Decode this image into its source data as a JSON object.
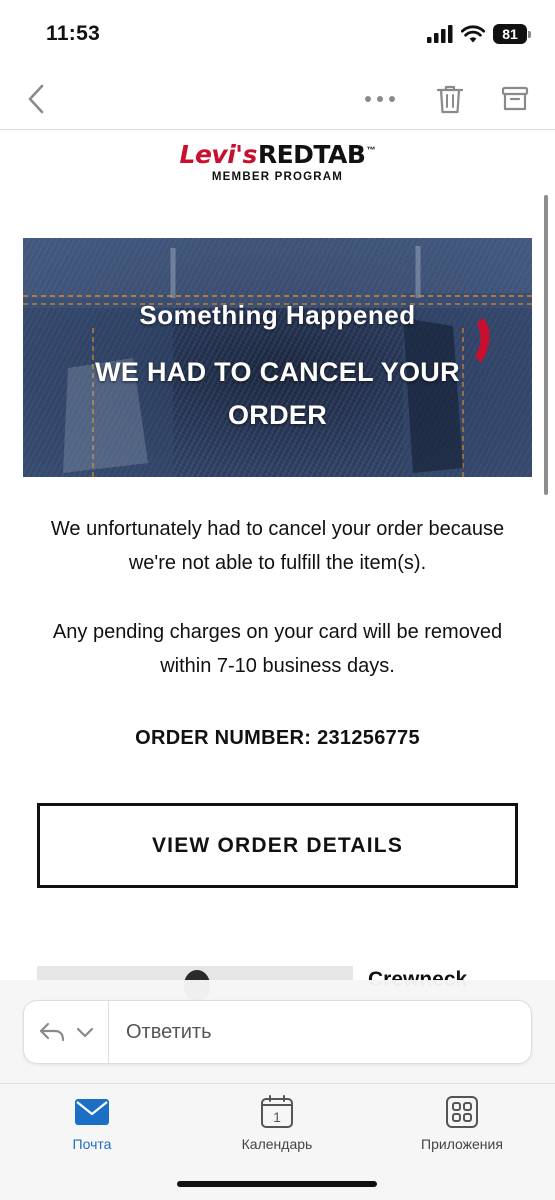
{
  "status_bar": {
    "time": "11:53",
    "battery_level": "81"
  },
  "toolbar": {
    "back_icon": "chevron-left-icon",
    "more_icon": "more-horizontal-icon",
    "trash_icon": "trash-icon",
    "archive_icon": "archive-icon"
  },
  "email": {
    "brand": {
      "logo_part1": "Levi's",
      "logo_part2": "REDTAB",
      "logo_tm": "™",
      "subtitle": "MEMBER PROGRAM"
    },
    "hero": {
      "kicker": "Something Happened",
      "title": "WE HAD TO CANCEL YOUR ORDER"
    },
    "paragraph_1": "We unfortunately had to cancel your order because we're not able to fulfill the item(s).",
    "paragraph_2": "Any pending charges on your card will be removed within 7-10 business days.",
    "order_number_label": "ORDER NUMBER:",
    "order_number_value": "231256775",
    "view_order_button": "VIEW ORDER DETAILS",
    "product_name": "Crewneck"
  },
  "reply": {
    "placeholder": "Ответить"
  },
  "tab_bar": {
    "tabs": [
      {
        "label": "Почта",
        "icon": "mail-icon",
        "active": true
      },
      {
        "label": "Календарь",
        "icon": "calendar-icon",
        "day": "1",
        "active": false
      },
      {
        "label": "Приложения",
        "icon": "apps-grid-icon",
        "active": false
      }
    ]
  },
  "colors": {
    "accent": "#1b6fc7",
    "brand_red": "#c8102e",
    "denim": "#2a3b5e"
  }
}
